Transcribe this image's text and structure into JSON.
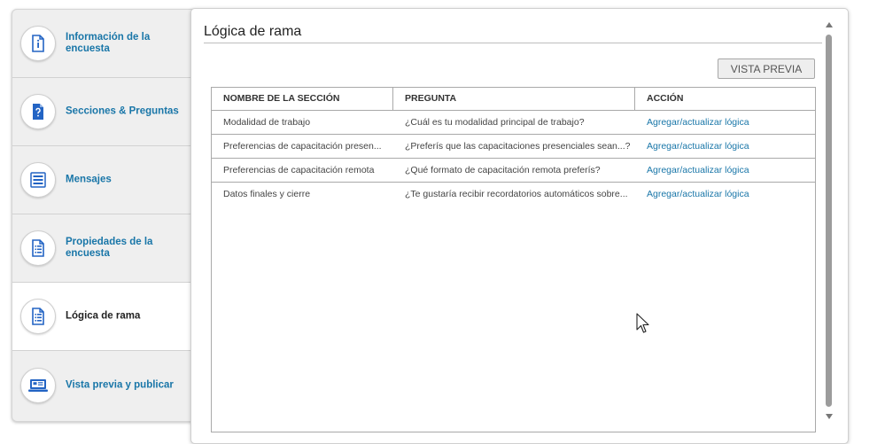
{
  "sidebar": {
    "items": [
      {
        "label": "Información de la encuesta",
        "icon": "info-document-icon",
        "active": false
      },
      {
        "label": "Secciones & Preguntas",
        "icon": "question-document-icon",
        "active": false
      },
      {
        "label": "Mensajes",
        "icon": "message-lines-icon",
        "active": false
      },
      {
        "label": "Propiedades de la encuesta",
        "icon": "properties-list-icon",
        "active": false
      },
      {
        "label": "Lógica de rama",
        "icon": "branch-logic-list-icon",
        "active": true
      },
      {
        "label": "Vista previa y publicar",
        "icon": "laptop-preview-icon",
        "active": false
      }
    ]
  },
  "main": {
    "title": "Lógica de rama",
    "preview_button": "VISTA PREVIA",
    "table": {
      "headers": [
        "NOMBRE DE LA SECCIÓN",
        "PREGUNTA",
        "ACCIÓN"
      ],
      "rows": [
        {
          "section": "Modalidad de trabajo",
          "question": "¿Cuál es tu modalidad principal de trabajo?",
          "action": "Agregar/actualizar lógica"
        },
        {
          "section": "Preferencias de capacitación presen...",
          "question": "¿Preferís que las capacitaciones presenciales sean...?",
          "action": "Agregar/actualizar lógica"
        },
        {
          "section": "Preferencias de capacitación remota",
          "question": "¿Qué formato de capacitación remota preferís?",
          "action": "Agregar/actualizar lógica"
        },
        {
          "section": "Datos finales y cierre",
          "question": "¿Te gustaría recibir recordatorios automáticos sobre...",
          "action": "Agregar/actualizar lógica"
        }
      ]
    }
  },
  "colors": {
    "accent": "#1976a8",
    "icon": "#2364c4",
    "sidebar_bg": "#efefef"
  }
}
